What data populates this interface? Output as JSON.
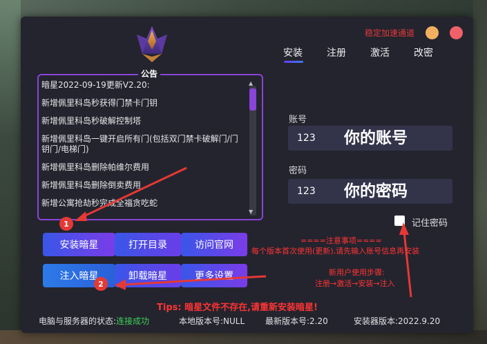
{
  "window": {
    "channel_link": "稳定加速通道",
    "logo_icon": "crown-gem-logo"
  },
  "tabs": [
    "安装",
    "注册",
    "激活",
    "改密"
  ],
  "notice": {
    "title": "公告",
    "items": [
      "暗星2022-09-19更新V2.20:",
      "新增佩里科岛秒获得门禁卡门钥",
      "新增佩里科岛秒破解控制塔",
      "新增佩里科岛一键开启所有门(包括双门禁卡破解门/门钥门/电梯门)",
      "新增佩里科岛删除帕维尔费用",
      "新增佩里科岛删除倒卖费用",
      "新增公寓抢劫秒完成全福贪吃蛇"
    ]
  },
  "account": {
    "label": "账号",
    "value": "123",
    "hint": "你的账号"
  },
  "password": {
    "label": "密码",
    "value": "123",
    "hint": "你的密码"
  },
  "remember_label": "记住密码",
  "buttons": {
    "install": "安装暗星",
    "open_dir": "打开目录",
    "visit_site": "访问官网",
    "inject": "注入暗星",
    "uninstall": "卸载暗星",
    "more_settings": "更多设置"
  },
  "notes": {
    "notice_title": "====注意事项====",
    "notice_body": "每个版本首次使用(更新),请先输入账号信息再安装",
    "new_user_title": "新用户使用步骤:",
    "new_user_steps": "注册→激活→安装→注入"
  },
  "tips": "Tips: 暗星文件不存在,请重新安装暗星!",
  "status": {
    "connection_label": "电脑与服务器的状态:",
    "connection_value": "连接成功",
    "local_version": "本地版本号:NULL",
    "latest_version": "最新版本号:2.20",
    "installer_version": "安装器版本:2022.9.20"
  },
  "badges": [
    "1",
    "2"
  ],
  "colors": {
    "accent_purple": "#8a44d8",
    "button_blue": "#3a56e8",
    "warning_red": "#ff3434",
    "success_green": "#3ed05a"
  }
}
